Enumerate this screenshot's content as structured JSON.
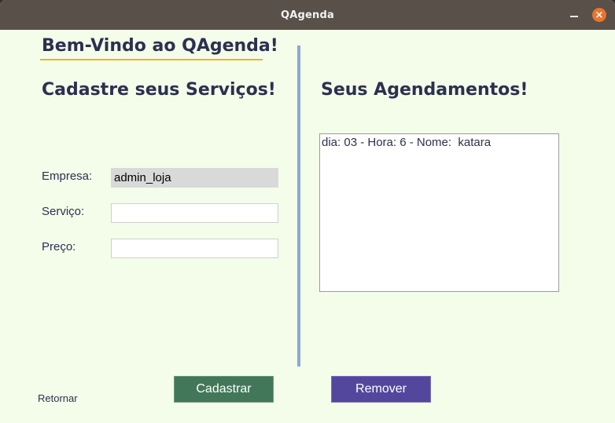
{
  "window": {
    "title": "QAgenda",
    "close_glyph": "×",
    "close_color": "#e9742d"
  },
  "welcome": "Bem-Vindo ao QAgenda!",
  "left": {
    "heading": "Cadastre seus Serviços!",
    "fields": {
      "empresa_label": "Empresa:",
      "empresa_value": "admin_loja",
      "servico_label": "Serviço:",
      "servico_value": "",
      "preco_label": "Preço:",
      "preco_value": ""
    }
  },
  "right": {
    "heading": "Seus Agendamentos!",
    "appointments": [
      "dia: 03 - Hora: 6 - Nome:  katara"
    ]
  },
  "buttons": {
    "cadastrar": "Cadastrar",
    "remover": "Remover",
    "retornar": "Retornar"
  },
  "colors": {
    "background": "#f4fde9",
    "heading": "#2c3050",
    "accent_underline": "#f0b41c",
    "divider": "#8aa9d4",
    "cadastrar": "#43775a",
    "remover": "#53479d"
  }
}
